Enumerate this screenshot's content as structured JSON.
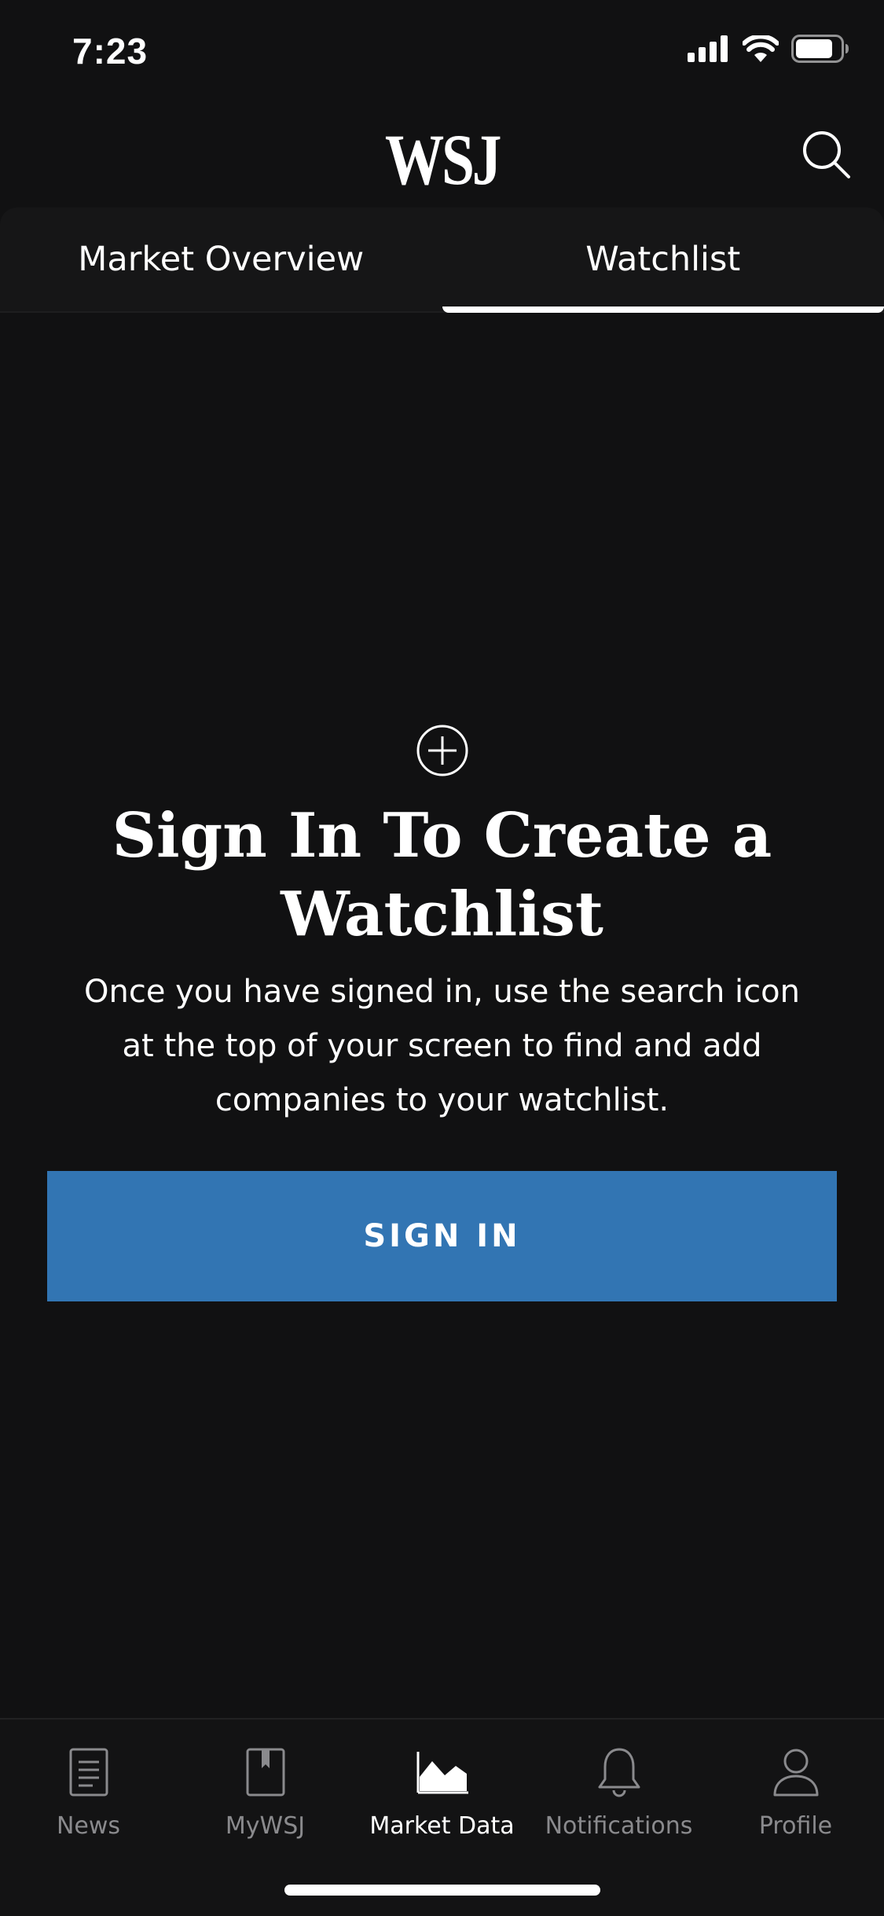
{
  "status_bar": {
    "time": "7:23",
    "icons": [
      "cellular-signal-icon",
      "wifi-icon",
      "battery-icon"
    ]
  },
  "header": {
    "logo": "WSJ",
    "search_icon": "search-icon"
  },
  "tabs": [
    {
      "label": "Market Overview",
      "active": false
    },
    {
      "label": "Watchlist",
      "active": true
    }
  ],
  "empty_state": {
    "icon": "plus-circle-icon",
    "title": "Sign In To Create a Watchlist",
    "description": "Once you have signed in, use the search icon at the top of your screen to find and add companies to your watchlist.",
    "button_label": "SIGN IN"
  },
  "tab_bar": {
    "items": [
      {
        "label": "News",
        "icon": "news-icon",
        "active": false
      },
      {
        "label": "MyWSJ",
        "icon": "bookmark-icon",
        "active": false
      },
      {
        "label": "Market Data",
        "icon": "area-chart-icon",
        "active": true
      },
      {
        "label": "Notifications",
        "icon": "bell-icon",
        "active": false
      },
      {
        "label": "Profile",
        "icon": "person-icon",
        "active": false
      }
    ]
  },
  "colors": {
    "background": "#111112",
    "accent_button": "#3275b3",
    "inactive_label": "#8a8a8d",
    "active_label": "#ffffff"
  }
}
